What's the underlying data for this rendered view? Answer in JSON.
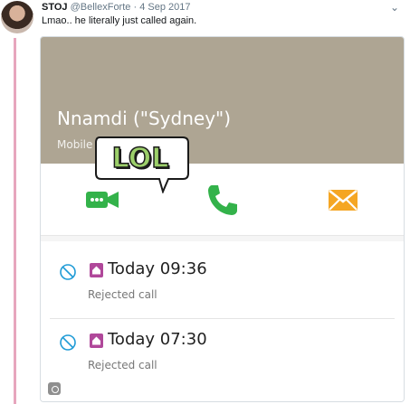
{
  "tweet": {
    "author_name": "STOJ",
    "author_handle": "@BellexForte",
    "separator": "·",
    "date": "4 Sep 2017",
    "text": "Lmao.. he literally just called again."
  },
  "contact": {
    "name": "Nnamdi (\"Sydney\")",
    "subtitle": "Mobile"
  },
  "sticker": {
    "text": "LOL"
  },
  "call_log": [
    {
      "time": "Today 09:36",
      "status": "Rejected call"
    },
    {
      "time": "Today 07:30",
      "status": "Rejected call"
    }
  ],
  "colors": {
    "header_bg": "#aea593",
    "video_icon": "#33b24a",
    "call_icon": "#33b24a",
    "message_icon": "#f5a623",
    "home_badge": "#b0489a",
    "block_icon": "#1f9bd6",
    "thread_line": "#e7a6bd"
  },
  "icons": [
    "video-call-icon",
    "phone-call-icon",
    "message-icon",
    "block-icon",
    "home-icon",
    "gif-icon",
    "chevron-down-icon"
  ]
}
